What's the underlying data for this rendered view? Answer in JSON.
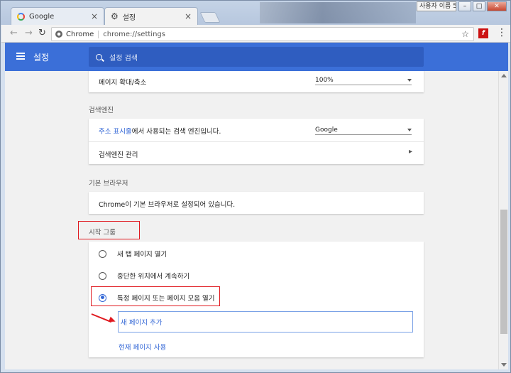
{
  "window": {
    "user_label": "사용자 이름 5",
    "controls": {
      "minimize": "–",
      "maximize": "□",
      "close": "✕"
    }
  },
  "tabs": [
    {
      "title": "Google",
      "icon": "google-icon",
      "active": false,
      "close": "×"
    },
    {
      "title": "설정",
      "icon": "gear-icon",
      "active": true,
      "close": "×"
    }
  ],
  "toolbar": {
    "back": "←",
    "forward": "→",
    "reload": "↻",
    "site_chip": "Chrome",
    "url": "chrome://settings",
    "star": "☆",
    "menu": "⋮",
    "flash_icon": "f"
  },
  "header": {
    "title": "설정",
    "search_placeholder": "설정 검색",
    "color": "#3b6fd8"
  },
  "sections": {
    "zoom": {
      "label": "페이지 확대/축소",
      "value": "100%"
    },
    "search_engine": {
      "title": "검색엔진",
      "address_bar_link": "주소 표시줄",
      "address_bar_rest": "에서 사용되는 검색 엔진입니다.",
      "engine_value": "Google",
      "manage_label": "검색엔진 관리",
      "manage_arrow": "▸"
    },
    "default_browser": {
      "title": "기본 브라우저",
      "text": "Chrome이 기본 브라우저로 설정되어 있습니다."
    },
    "startup": {
      "title": "시작 그룹",
      "options": [
        {
          "label": "새 탭 페이지 열기",
          "checked": false
        },
        {
          "label": "중단한 위치에서 계속하기",
          "checked": false
        },
        {
          "label": "특정 페이지 또는 페이지 모음 열기",
          "checked": true
        }
      ],
      "add_page": "새 페이지 추가",
      "use_current": "현재 페이지 사용"
    }
  },
  "annotation_color": "#e0191f",
  "link_color": "#3367d6"
}
